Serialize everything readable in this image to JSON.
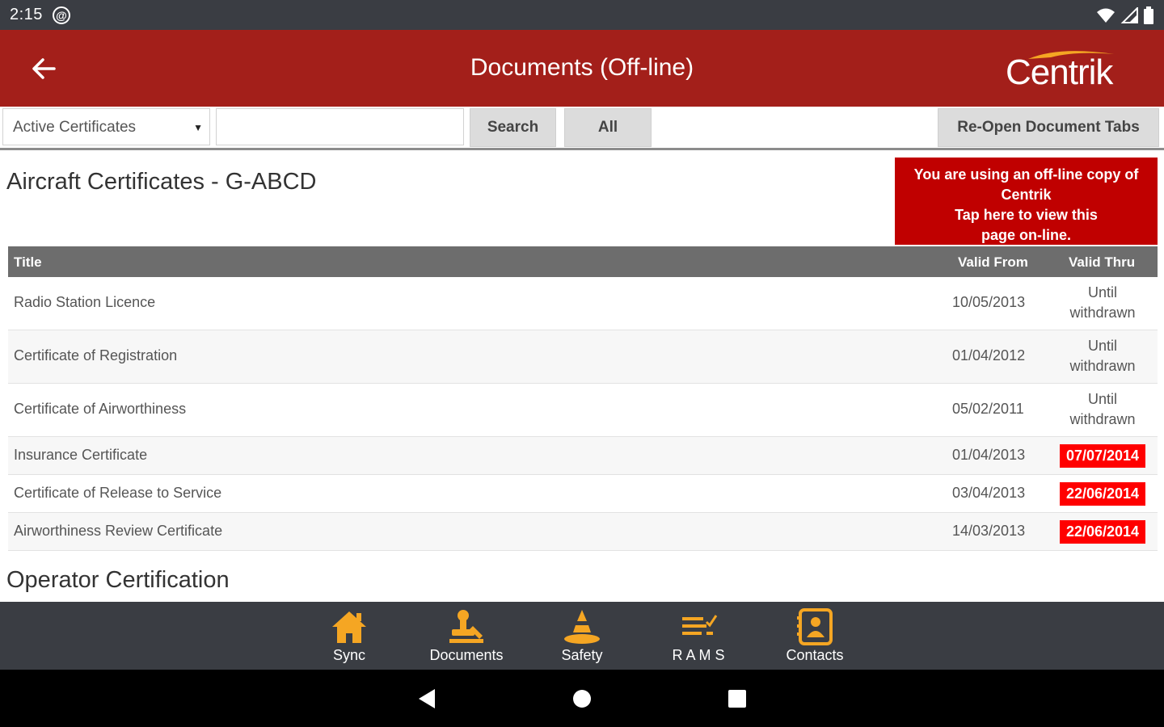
{
  "status": {
    "time": "2:15"
  },
  "header": {
    "title": "Documents (Off-line)",
    "logo_text": "Centrik"
  },
  "toolbar": {
    "select_value": "Active Certificates",
    "search_value": "",
    "search_label": "Search",
    "all_label": "All",
    "reopen_label": "Re-Open Document Tabs"
  },
  "offline_banner": {
    "line1": "You are using an off-line copy of",
    "line2": "Centrik",
    "line3": "Tap here to view this",
    "line4": "page on-line."
  },
  "sections": {
    "aircraft_title": "Aircraft Certificates - G-ABCD",
    "operator_title": "Operator Certification"
  },
  "table": {
    "headers": {
      "title": "Title",
      "valid_from": "Valid From",
      "valid_thru": "Valid Thru"
    },
    "rows": [
      {
        "title": "Radio Station Licence",
        "valid_from": "10/05/2013",
        "valid_thru_line1": "Until",
        "valid_thru_line2": "withdrawn"
      },
      {
        "title": "Certificate of Registration",
        "valid_from": "01/04/2012",
        "valid_thru_line1": "Until",
        "valid_thru_line2": "withdrawn"
      },
      {
        "title": "Certificate of Airworthiness",
        "valid_from": "05/02/2011",
        "valid_thru_line1": "Until",
        "valid_thru_line2": "withdrawn"
      },
      {
        "title": "Insurance Certificate",
        "valid_from": "01/04/2013",
        "valid_thru": "07/07/2014"
      },
      {
        "title": "Certificate of Release to Service",
        "valid_from": "03/04/2013",
        "valid_thru": "22/06/2014"
      },
      {
        "title": "Airworthiness Review Certificate",
        "valid_from": "14/03/2013",
        "valid_thru": "22/06/2014"
      }
    ]
  },
  "tabs": [
    {
      "label": "Sync",
      "icon": "home-icon"
    },
    {
      "label": "Documents",
      "icon": "stamp-icon"
    },
    {
      "label": "Safety",
      "icon": "cone-icon"
    },
    {
      "label": "R A M S",
      "icon": "checklist-icon"
    },
    {
      "label": "Contacts",
      "icon": "contact-icon"
    }
  ],
  "colors": {
    "header": "#a31f1a",
    "accent": "#f5a623",
    "expired": "#ff0000",
    "banner": "#c00000",
    "tabbar": "#3a3d43"
  }
}
